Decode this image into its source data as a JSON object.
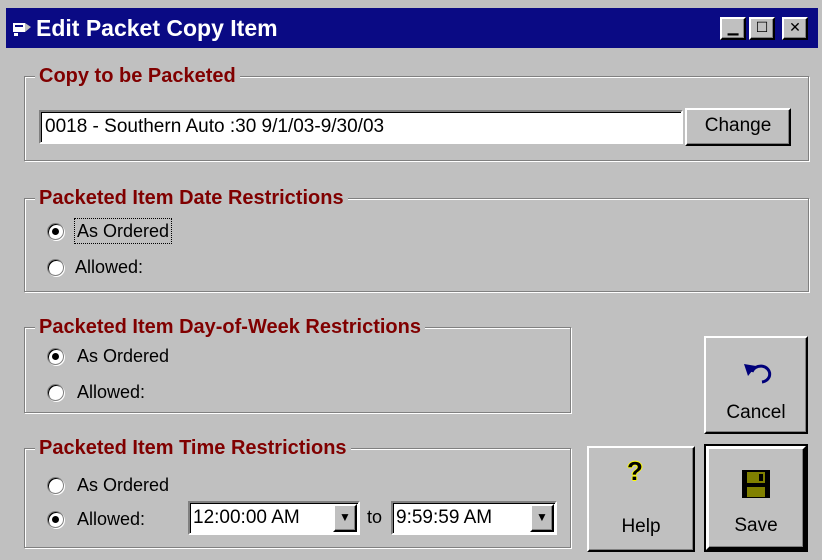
{
  "window": {
    "title": "Edit Packet Copy Item",
    "min_glyph": "▁",
    "max_glyph": "☐",
    "close_glyph": "✕"
  },
  "copy_group": {
    "title": "Copy to be Packeted",
    "value": "0018 - Southern Auto :30 9/1/03-9/30/03",
    "change_label": "Change"
  },
  "date_group": {
    "title": "Packeted Item Date Restrictions",
    "as_ordered_label": "As Ordered",
    "allowed_label": "Allowed:",
    "selected": "as_ordered"
  },
  "dow_group": {
    "title": "Packeted Item Day-of-Week Restrictions",
    "as_ordered_label": "As Ordered",
    "allowed_label": "Allowed:",
    "selected": "as_ordered"
  },
  "time_group": {
    "title": "Packeted Item Time Restrictions",
    "as_ordered_label": "As Ordered",
    "allowed_label": "Allowed:",
    "selected": "allowed",
    "from_value": "12:00:00 AM",
    "to_label": "to",
    "to_value": "9:59:59 AM"
  },
  "buttons": {
    "cancel_label": "Cancel",
    "help_label": "Help",
    "save_label": "Save"
  },
  "colors": {
    "title_bar": "#0a0a84",
    "group_title": "#800000",
    "face": "#c0c0c0"
  }
}
